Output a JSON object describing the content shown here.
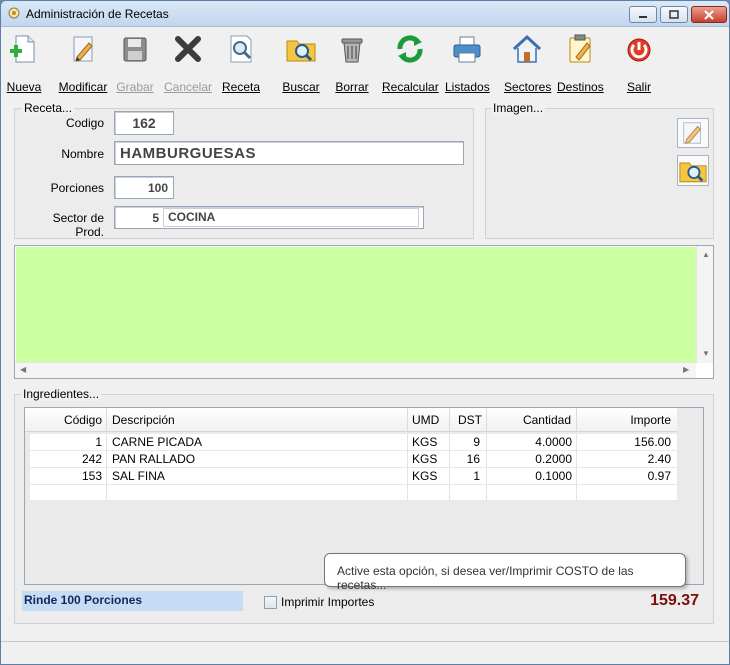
{
  "window": {
    "title": "Administración de Recetas"
  },
  "toolbar": {
    "nueva": "Nueva",
    "modificar": "Modificar",
    "grabar": "Grabar",
    "cancelar": "Cancelar",
    "receta": "Receta",
    "buscar": "Buscar",
    "borrar": "Borrar",
    "recalcular": "Recalcular",
    "listados": "Listados",
    "sectores": "Sectores",
    "destinos": "Destinos",
    "salir": "Salir"
  },
  "receta": {
    "group_label": "Receta...",
    "codigo_label": "Codigo",
    "codigo": "162",
    "nombre_label": "Nombre",
    "nombre": "HAMBURGUESAS",
    "porciones_label": "Porciones",
    "porciones": "100",
    "sector_label": "Sector de Prod.",
    "sector_code": "5",
    "sector_name": "COCINA"
  },
  "imagen": {
    "group_label": "Imagen..."
  },
  "ingredientes": {
    "group_label": "Ingredientes...",
    "columns": [
      "Código",
      "Descripción",
      "UMD",
      "DST",
      "Cantidad",
      "Importe"
    ],
    "rows": [
      {
        "codigo": "1",
        "descripcion": "CARNE PICADA",
        "umd": "KGS",
        "dst": "9",
        "cantidad": "4.0000",
        "importe": "156.00"
      },
      {
        "codigo": "242",
        "descripcion": "PAN RALLADO",
        "umd": "KGS",
        "dst": "16",
        "cantidad": "0.2000",
        "importe": "2.40"
      },
      {
        "codigo": "153",
        "descripcion": "SAL FINA",
        "umd": "KGS",
        "dst": "1",
        "cantidad": "0.1000",
        "importe": "0.97"
      }
    ]
  },
  "footer": {
    "rinde": "Rinde 100 Porciones",
    "imprimir_label": "Imprimir Importes",
    "total": "159.37",
    "tooltip": "Active esta opción, si desea ver/Imprimir COSTO de las recetas..."
  },
  "colors": {
    "memo_bg": "#ccffa0",
    "total": "#7a0f0f",
    "rinde_bg": "#c6dcf5"
  },
  "icons": [
    "recipe-app-icon",
    "new-doc-icon",
    "edit-pencil-icon",
    "save-disk-icon",
    "cancel-x-icon",
    "preview-magnifier-icon",
    "search-folder-icon",
    "trash-icon",
    "recalc-arrows-icon",
    "printer-icon",
    "house-icon",
    "clipboard-icon",
    "power-icon"
  ]
}
